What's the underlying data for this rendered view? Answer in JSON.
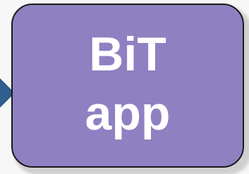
{
  "diagram": {
    "node": {
      "lines": [
        "BiT",
        "app"
      ],
      "fill_color": "#8f80c2",
      "border_color": "#1a1a1a",
      "text_color": "#ffffff"
    },
    "connector": {
      "color": "#2f5f8f",
      "icon": "arrow-right-icon"
    }
  }
}
